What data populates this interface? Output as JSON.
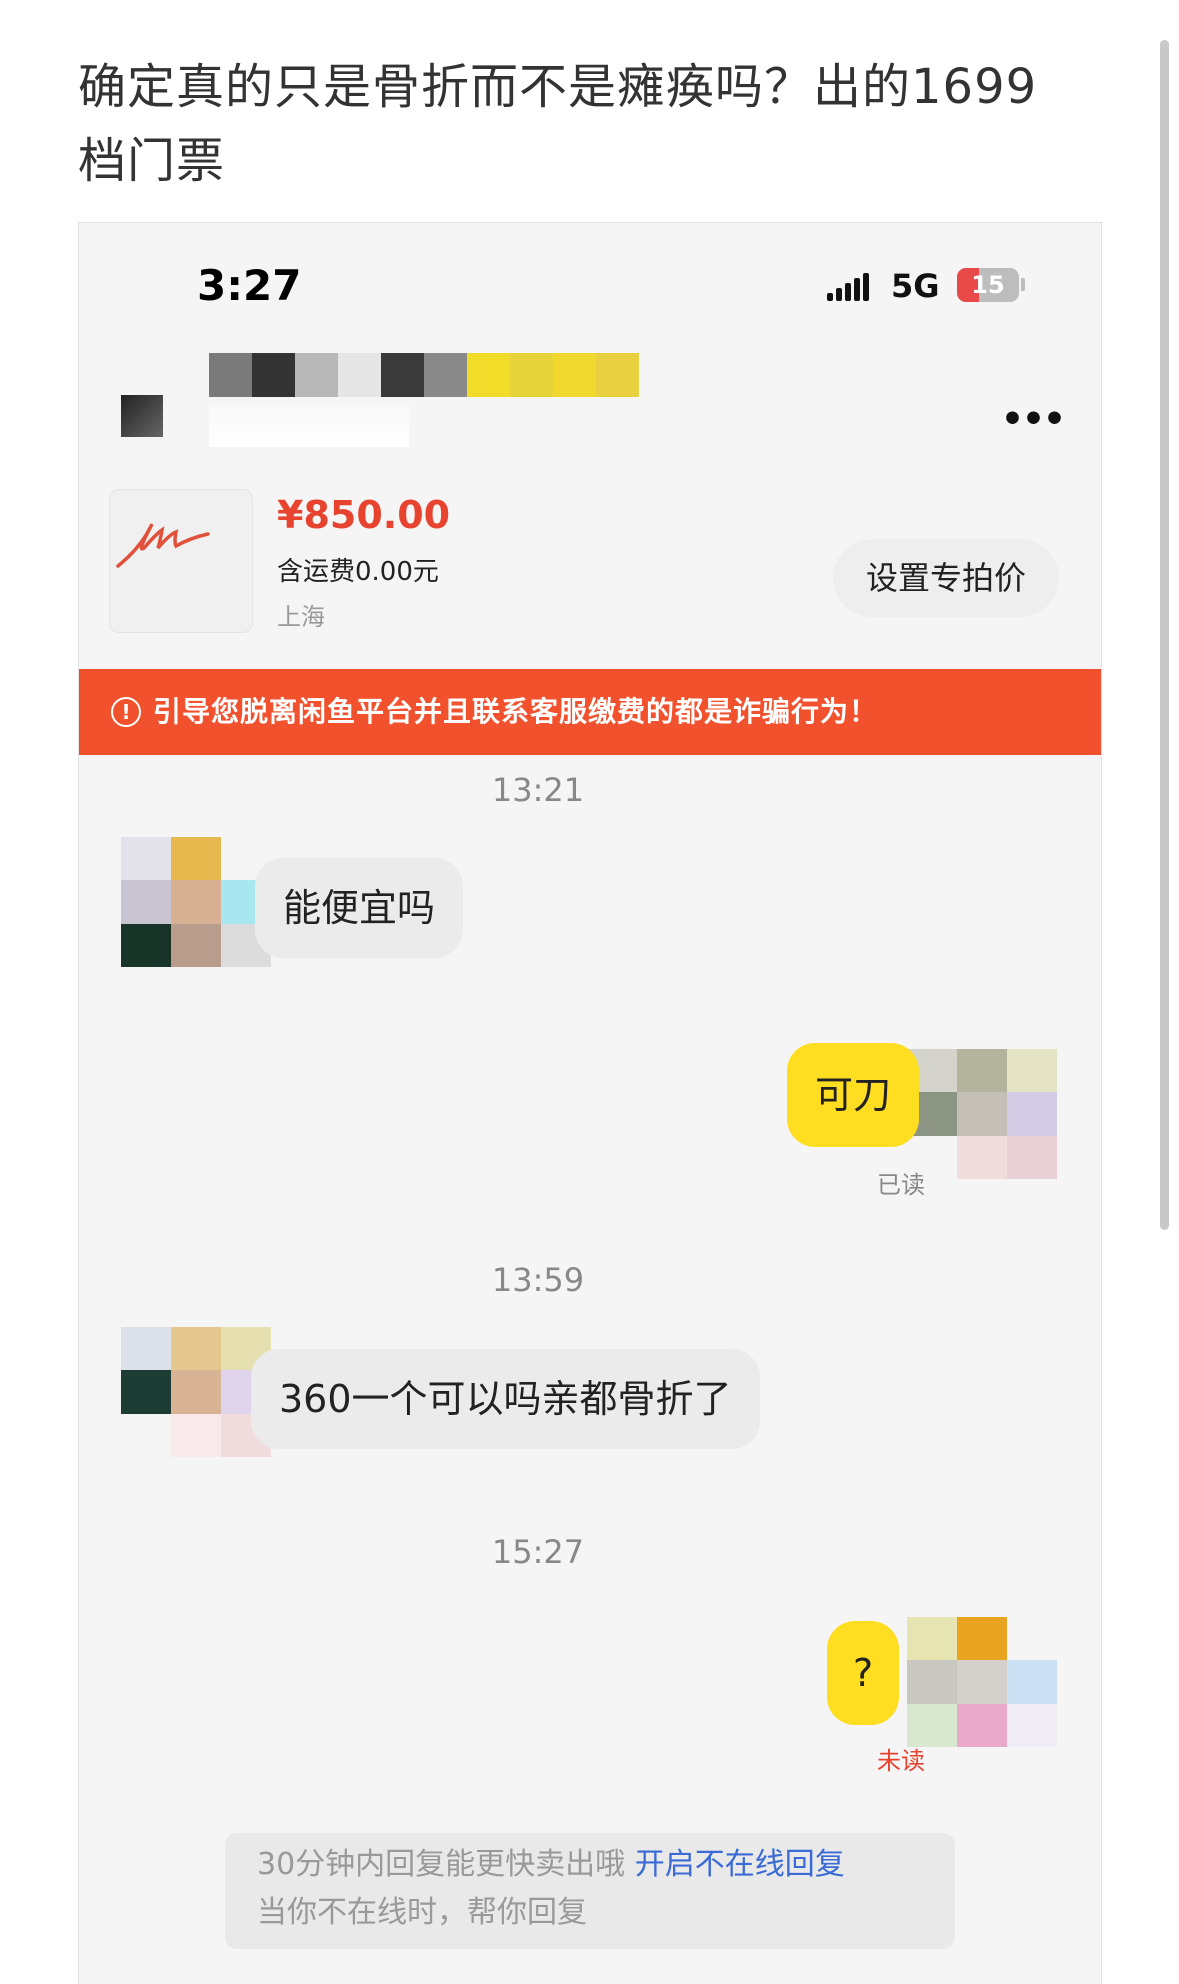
{
  "post": {
    "title": "确定真的只是骨折而不是瘫痪吗？出的1699档门票"
  },
  "status_bar": {
    "time": "3:27",
    "network": "5G",
    "battery_level": "15",
    "battery_fraction": 0.15
  },
  "nav": {
    "more_label": "•••"
  },
  "product": {
    "price": "¥850.00",
    "shipping": "含运费0.00元",
    "location": "上海",
    "set_price_label": "设置专拍价"
  },
  "banner": {
    "icon": "!",
    "text": "引导您脱离闲鱼平台并且联系客服缴费的都是诈骗行为！"
  },
  "chat": {
    "messages": [
      {
        "time": "13:21",
        "sender": "buyer",
        "text": "能便宜吗"
      },
      {
        "sender": "seller",
        "text": "可刀",
        "status": "已读"
      },
      {
        "time": "13:59",
        "sender": "buyer",
        "text": "360一个可以吗亲都骨折了"
      },
      {
        "time": "15:27",
        "sender": "seller",
        "text": "?",
        "status": "未读"
      }
    ]
  },
  "reply_tip": {
    "text": "30分钟内回复能更快卖出哦",
    "link": "开启不在线回复",
    "subtext": "当你不在线时，帮你回复"
  },
  "colors": {
    "accent_yellow": "#ffdd21",
    "price_red": "#e8432f",
    "banner_orange": "#f2512d",
    "link_blue": "#3a6ad6"
  }
}
